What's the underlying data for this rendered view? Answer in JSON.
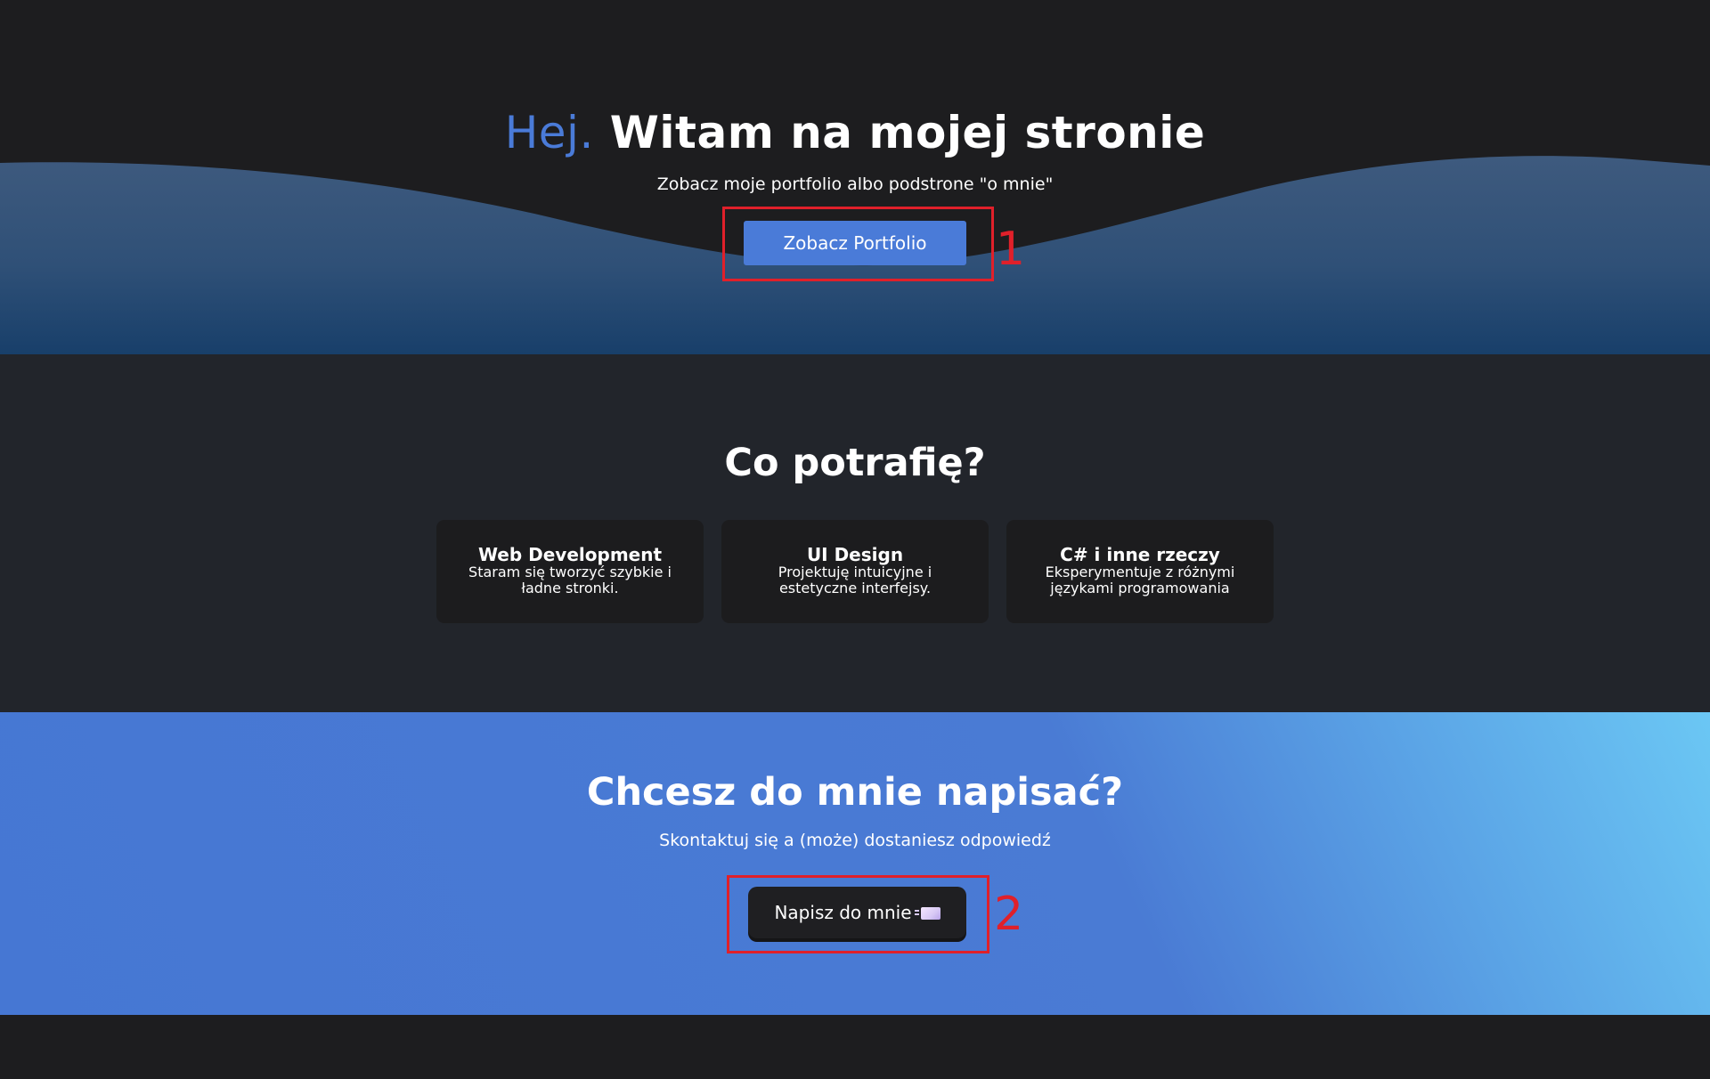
{
  "hero": {
    "title_accent": "Hej.",
    "title_main": "Witam na mojej stronie",
    "subtitle": "Zobacz moje portfolio albo podstrone \"o mnie\"",
    "button_label": "Zobacz Portfolio"
  },
  "skills": {
    "title": "Co potrafię?",
    "cards": [
      {
        "title": "Web Development",
        "desc": "Staram się tworzyć szybkie i ładne stronki."
      },
      {
        "title": "UI Design",
        "desc": "Projektuję intuicyjne i estetyczne interfejsy."
      },
      {
        "title": "C# i inne rzeczy",
        "desc": "Eksperymentuje z różnymi językami programowania"
      }
    ]
  },
  "contact": {
    "title": "Chcesz do mnie napisać?",
    "subtitle": "Skontaktuj się a (może) dostaniesz odpowiedź",
    "button_label": "Napisz do mnie",
    "button_icon": "mail-icon"
  },
  "annotations": {
    "first": "1",
    "second": "2"
  },
  "colors": {
    "accent": "#4a7bd8",
    "background": "#1d1d1f",
    "section_dark": "#22252b",
    "annotation_red": "#e0202a"
  }
}
